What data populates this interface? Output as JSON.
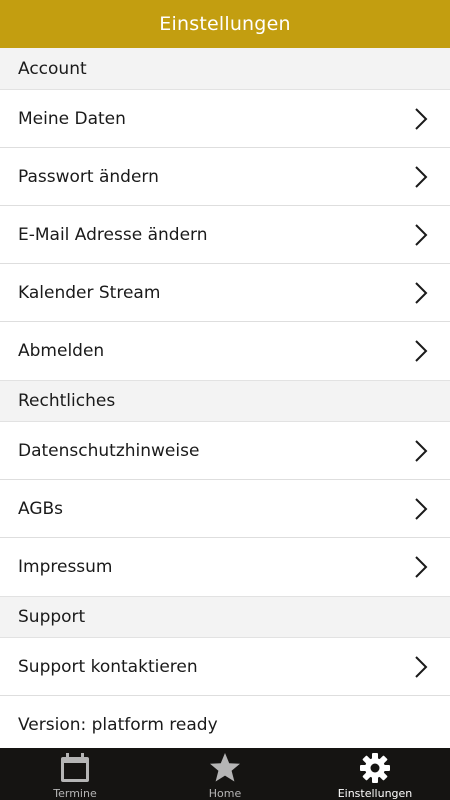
{
  "header": {
    "title": "Einstellungen"
  },
  "sections": [
    {
      "title": "Account",
      "items": [
        {
          "label": "Meine Daten",
          "icon": "chevron-right-icon"
        },
        {
          "label": "Passwort ändern",
          "icon": "chevron-right-icon"
        },
        {
          "label": "E-Mail Adresse ändern",
          "icon": "chevron-right-icon"
        },
        {
          "label": "Kalender Stream",
          "icon": "chevron-right-icon"
        },
        {
          "label": "Abmelden",
          "icon": "chevron-right-icon"
        }
      ]
    },
    {
      "title": "Rechtliches",
      "items": [
        {
          "label": "Datenschutzhinweise",
          "icon": "chevron-right-icon"
        },
        {
          "label": "AGBs",
          "icon": "chevron-right-icon"
        },
        {
          "label": "Impressum",
          "icon": "chevron-right-icon"
        }
      ]
    },
    {
      "title": "Support",
      "items": [
        {
          "label": "Support kontaktieren",
          "icon": "chevron-right-icon"
        }
      ],
      "version_text": "Version: platform ready"
    }
  ],
  "tabbar": {
    "tabs": [
      {
        "label": "Termine",
        "icon": "calendar-icon",
        "active": false
      },
      {
        "label": "Home",
        "icon": "star-icon",
        "active": false
      },
      {
        "label": "Einstellungen",
        "icon": "gear-icon",
        "active": true
      }
    ]
  },
  "colors": {
    "header_bg": "#c39e10",
    "section_bg": "#f3f3f3",
    "tabbar_bg": "#151412"
  }
}
